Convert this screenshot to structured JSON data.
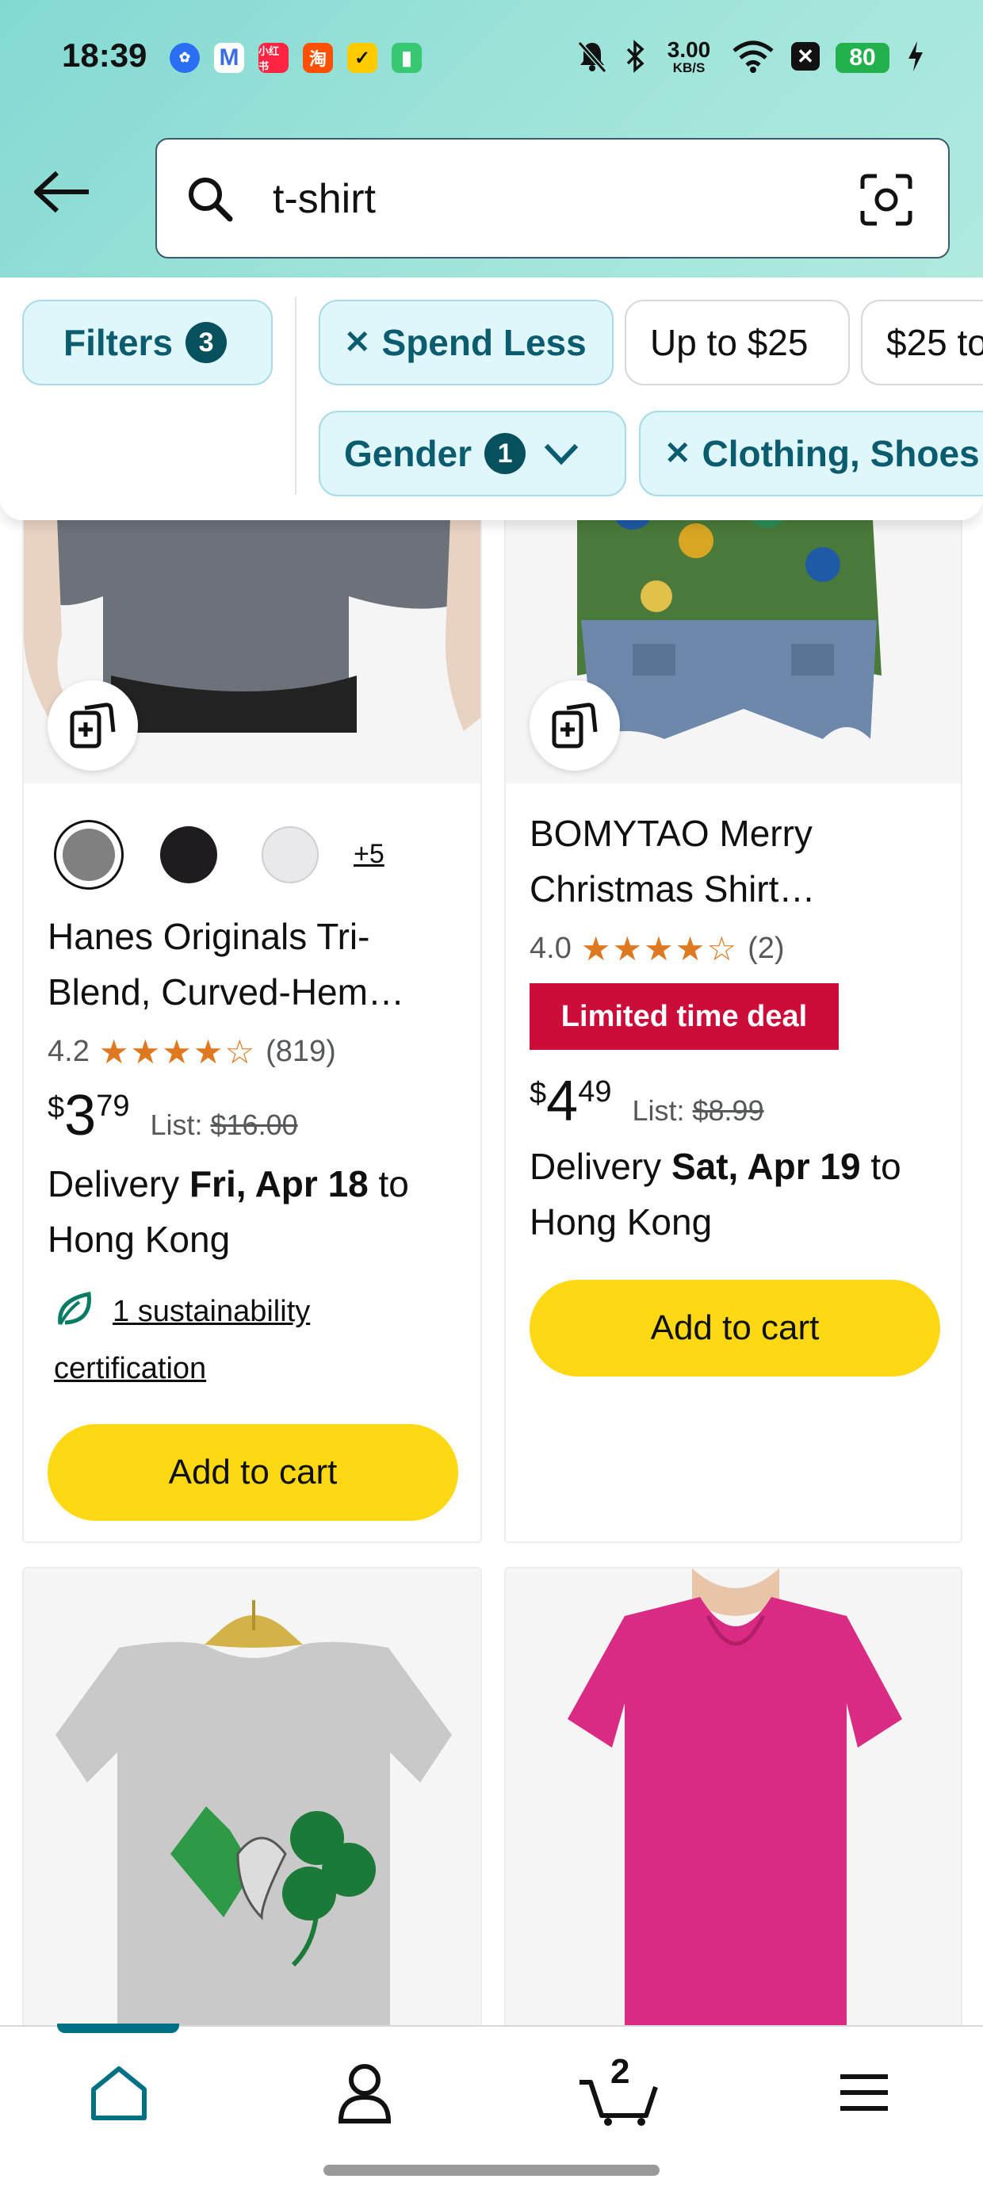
{
  "status_bar": {
    "time": "18:39",
    "network_speed_value": "3.00",
    "network_speed_unit": "KB/S",
    "battery": "80",
    "app_icons": [
      "app-icon",
      "gmail-icon",
      "xiaohongshu-icon",
      "taobao-icon",
      "app-icon",
      "app-icon"
    ]
  },
  "search": {
    "query": "t-shirt"
  },
  "filters": {
    "filters_label": "Filters",
    "filters_count": "3",
    "spend_less": "Spend Less",
    "up_to_25": "Up to $25",
    "range_25": "$25 to",
    "gender": "Gender",
    "gender_count": "1",
    "clothing": "Clothing, Shoes"
  },
  "products": [
    {
      "swatch_more": "+5",
      "title": "Hanes Originals Tri-Blend, Curved-Hem…",
      "rating": "4.2",
      "review_count": "(819)",
      "price_currency": "$",
      "price_whole": "3",
      "price_fraction": "79",
      "list_label": "List:",
      "list_price": "$16.00",
      "delivery_prefix": "Delivery ",
      "delivery_date": "Fri, Apr 18",
      "delivery_suffix": " to Hong Kong",
      "sustainability": "1 sustainability certification",
      "add_to_cart": "Add to cart"
    },
    {
      "title": "BOMYTAO Merry Christmas Shirt…",
      "rating": "4.0",
      "review_count": "(2)",
      "deal_badge": "Limited time deal",
      "price_currency": "$",
      "price_whole": "4",
      "price_fraction": "49",
      "list_label": "List:",
      "list_price": "$8.99",
      "delivery_prefix": "Delivery ",
      "delivery_date": "Sat, Apr 19",
      "delivery_suffix": " to Hong Kong",
      "add_to_cart": "Add to cart"
    }
  ],
  "nav": {
    "cart_count": "2",
    "items": [
      "home-icon",
      "account-icon",
      "cart-icon",
      "menu-icon"
    ]
  },
  "colors": {
    "accent_teal": "#07505e",
    "cart_button": "#ffd814",
    "deal_red": "#cc0c39",
    "star_orange": "#de7921"
  }
}
